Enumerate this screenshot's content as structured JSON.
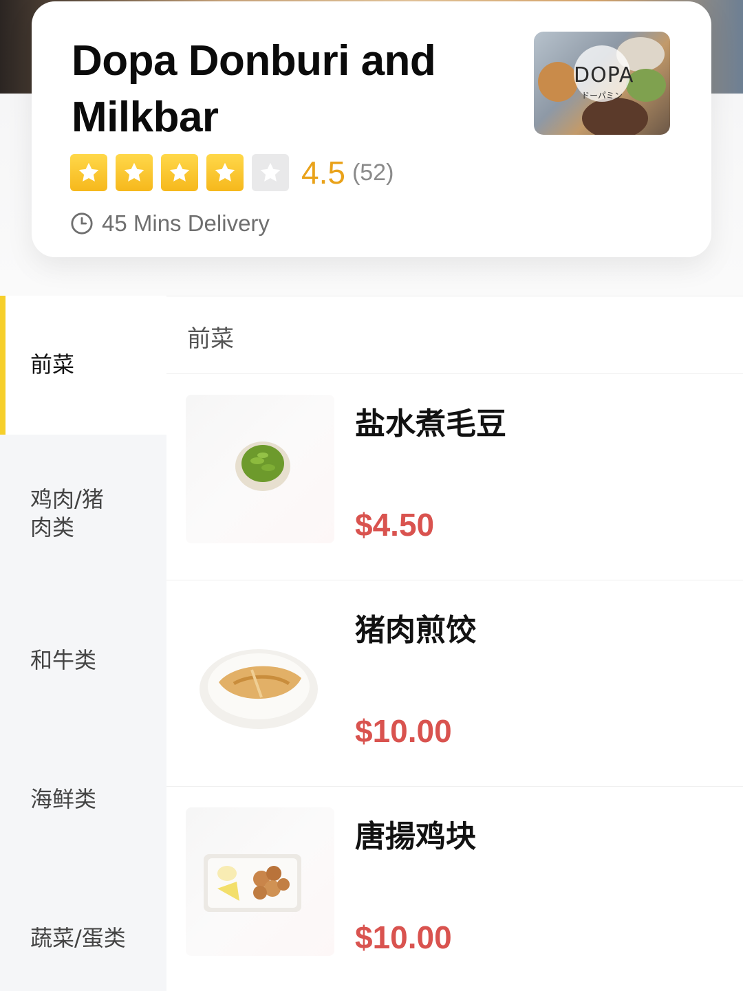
{
  "store": {
    "name": "Dopa Donburi and Milkbar",
    "rating_value": "4.5",
    "rating_count": "(52)",
    "stars_filled": 4,
    "stars_total": 5,
    "delivery": "45 Mins Delivery",
    "thumb_logo": "DOPA",
    "thumb_logo_sub": "ドーパミン"
  },
  "categories": [
    {
      "label": "前菜",
      "active": true
    },
    {
      "label": "鸡肉/猪肉类",
      "active": false
    },
    {
      "label": "和牛类",
      "active": false
    },
    {
      "label": "海鲜类",
      "active": false
    },
    {
      "label": "蔬菜/蛋类",
      "active": false
    }
  ],
  "section": {
    "title": "前菜"
  },
  "dishes": [
    {
      "name": "盐水煮毛豆",
      "price": "$4.50",
      "image": "edamame-bowl"
    },
    {
      "name": "猪肉煎饺",
      "price": "$10.00",
      "image": "gyoza-plate"
    },
    {
      "name": "唐揚鸡块",
      "price": "$10.00",
      "image": "karaage-plate"
    }
  ],
  "colors": {
    "accent_yellow": "#f6cf2b",
    "rating_orange": "#e9a21a",
    "price_red": "#d9534f",
    "sidebar_bg": "#f5f6f8"
  },
  "icons": {
    "star": "star-icon",
    "clock": "clock-icon"
  }
}
